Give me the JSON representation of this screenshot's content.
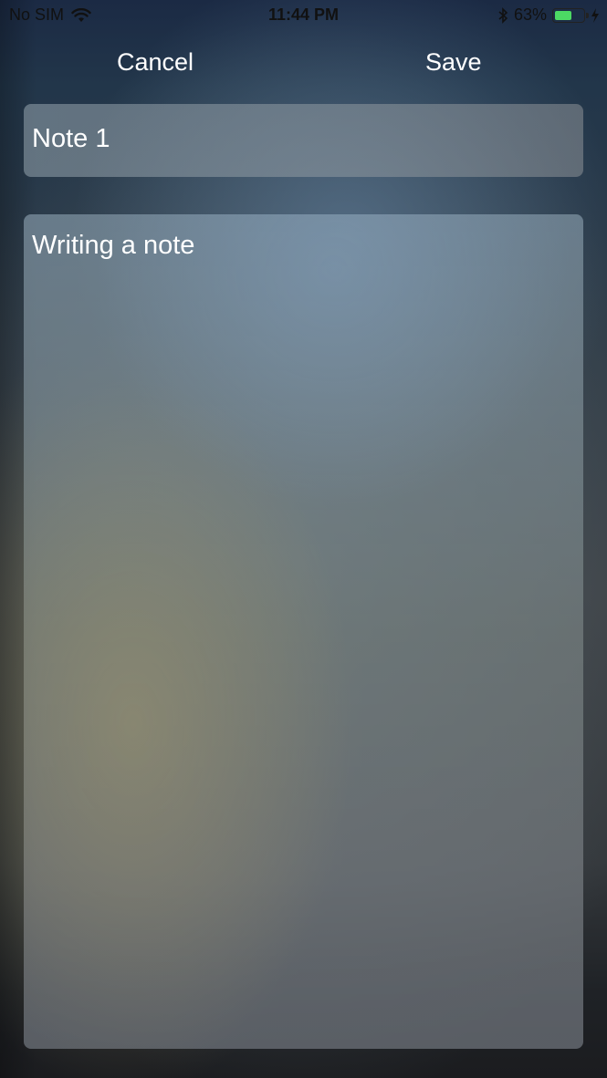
{
  "status_bar": {
    "carrier": "No SIM",
    "time": "11:44 PM",
    "battery_percent": "63%",
    "battery_level": 0.63,
    "battery_color": "#4cd964",
    "icons": [
      "wifi-icon",
      "bluetooth-icon",
      "battery-icon",
      "charging-bolt-icon"
    ]
  },
  "nav": {
    "cancel_label": "Cancel",
    "save_label": "Save"
  },
  "note": {
    "title": "Note 1",
    "body": "Writing a note"
  }
}
